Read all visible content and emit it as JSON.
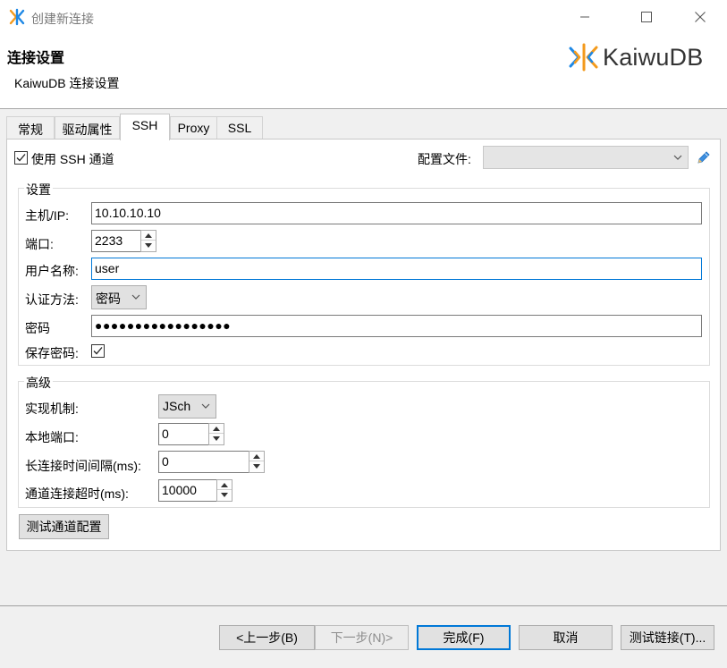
{
  "window": {
    "title": "创建新连接",
    "header_title": "连接设置",
    "header_subtitle": "KaiwuDB 连接设置",
    "logo_text": "KaiwuDB"
  },
  "tabs": [
    {
      "label": "常规"
    },
    {
      "label": "驱动属性"
    },
    {
      "label": "SSH",
      "active": true
    },
    {
      "label": "Proxy"
    },
    {
      "label": "SSL"
    }
  ],
  "ssh": {
    "use_ssh_label": "使用 SSH 通道",
    "use_ssh_checked": true,
    "profile_label": "配置文件:",
    "profile_value": "",
    "settings_group": "设置",
    "host_label": "主机/IP:",
    "host_value": "10.10.10.10",
    "port_label": "端口:",
    "port_value": "2233",
    "user_label": "用户名称:",
    "user_value": "user",
    "auth_label": "认证方法:",
    "auth_value": "密码",
    "password_label": "密码",
    "password_value": "●●●●●●●●●●●●●●●●●",
    "save_password_label": "保存密码:",
    "save_password_checked": true,
    "advanced_group": "高级",
    "impl_label": "实现机制:",
    "impl_value": "JSch",
    "local_port_label": "本地端口:",
    "local_port_value": "0",
    "keepalive_label": "长连接时间间隔(ms):",
    "keepalive_value": "0",
    "timeout_label": "通道连接超时(ms):",
    "timeout_value": "10000",
    "test_tunnel_button": "测试通道配置"
  },
  "footer": {
    "back_button": "<上一步(B)",
    "next_button": "下一步(N)>",
    "finish_button": "完成(F)",
    "cancel_button": "取消",
    "test_connection_button": "测试链接(T)..."
  },
  "colors": {
    "accent": "#0078d7",
    "logo_orange": "#f39a1c",
    "logo_blue": "#1e88e5"
  }
}
